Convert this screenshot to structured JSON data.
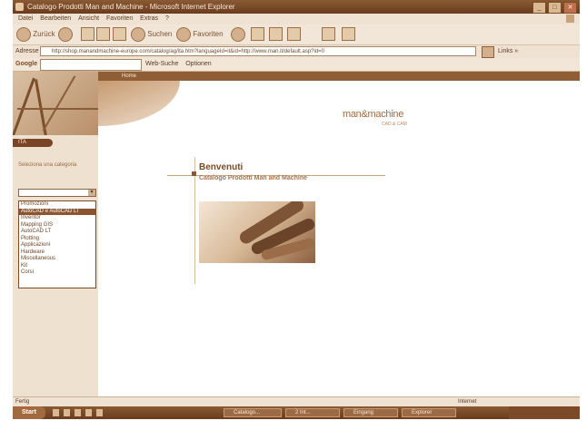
{
  "window": {
    "title": "Catalogo Prodotti Man and Machine - Microsoft Internet Explorer"
  },
  "menu": [
    "Datei",
    "Bearbeiten",
    "Ansicht",
    "Favoriten",
    "Extras",
    "?"
  ],
  "toolbar": {
    "back": "Zurück",
    "search": "Suchen",
    "favorites": "Favoriten"
  },
  "address": {
    "label": "Adresse",
    "url": "http://shop.manandmachine-europe.com/catalog/ag/ita.htm?languageId=it&id=http://www.man.it/default.asp?id=0",
    "links": "Links »"
  },
  "googlebar": {
    "logo": "Google",
    "web_search": "Web-Suche",
    "options": "Optionen"
  },
  "page": {
    "home": "Home",
    "nav_tab": "ITA",
    "brand": "man&machine",
    "brand_sub": "CAD & CAM",
    "sidebar_label": "Seleziona una categoria",
    "category_list": [
      "Promozioni",
      "AutoCAD e AutoCAD LT",
      "Inventor",
      "Mapping GIS",
      "AutoCAD LT",
      "Plotting",
      "Applicazioni",
      "Hardware",
      "Miscellaneous",
      "Kit",
      "Corsi"
    ],
    "selected_index": 1,
    "heading": "Benvenuti",
    "subheading": "Catalogo Prodotti Man and Machine"
  },
  "status": {
    "left": "Fertig",
    "right": "Internet"
  },
  "taskbar": {
    "start": "Start",
    "tasks": [
      "Catalogo...",
      "2 Int...",
      "Eingang",
      "Explorer"
    ]
  },
  "colors": {
    "accent": "#8a5530",
    "band": "#8f5d36"
  }
}
